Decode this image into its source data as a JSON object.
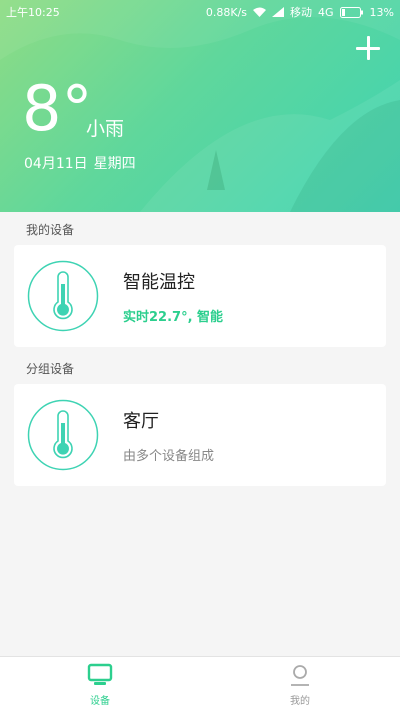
{
  "status_bar": {
    "time": "上午10:25",
    "net_speed": "0.88K/s",
    "carrier": "移动",
    "network": "4G",
    "battery": "13%"
  },
  "header": {
    "temperature": "8°",
    "weather": "小雨",
    "date": "04月11日",
    "weekday": "星期四",
    "add_icon": "plus-icon"
  },
  "my_devices": {
    "title": "我的设备",
    "items": [
      {
        "name": "智能温控",
        "status": "实时22.7°, 智能",
        "icon": "thermometer-icon"
      }
    ]
  },
  "group_devices": {
    "title": "分组设备",
    "items": [
      {
        "name": "客厅",
        "status": "由多个设备组成",
        "icon": "thermometer-icon"
      }
    ]
  },
  "tabs": [
    {
      "label": "设备",
      "icon": "monitor-icon",
      "active": true
    },
    {
      "label": "我的",
      "icon": "person-icon",
      "active": false
    }
  ],
  "colors": {
    "accent": "#2ccf8e",
    "header_start": "#8fdc84",
    "header_end": "#3ed3b3"
  }
}
